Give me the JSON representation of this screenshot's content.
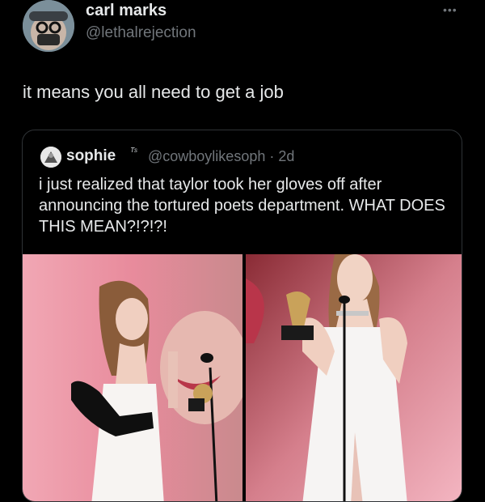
{
  "tweet": {
    "display_name": "carl marks",
    "handle": "@lethalrejection",
    "more_icon": "more-horizontal-icon",
    "text": "it means you all need to get a job"
  },
  "quoted_tweet": {
    "display_name": "sophie",
    "badge": "ᵀˢ",
    "handle_time": "@cowboylikesoph · 2d",
    "text": "i just realized that taylor took her gloves off after announcing the tortured poets department. WHAT DOES THIS MEAN?!?!?!",
    "images": [
      "photo-gloves-on",
      "photo-gloves-off"
    ]
  },
  "colors": {
    "background": "#000000",
    "text": "#e7e9ea",
    "muted": "#71767b",
    "card_border": "#2f3336"
  }
}
